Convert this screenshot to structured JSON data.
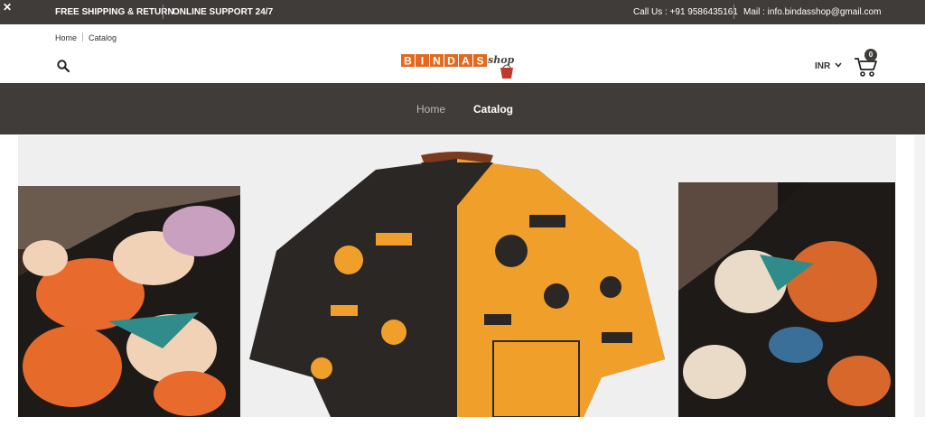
{
  "topbar": {
    "close_glyph": "✕",
    "shipping": "FREE SHIPPING & RETURN",
    "support": "ONLINE SUPPORT 24/7",
    "call": "Call Us : +91 9586435161",
    "mail": "Mail : info.bindasshop@gmail.com"
  },
  "breadcrumb": {
    "home": "Home",
    "catalog": "Catalog"
  },
  "header": {
    "currency": "INR",
    "cart_count": "0"
  },
  "logo": {
    "letters": [
      "B",
      "I",
      "N",
      "D",
      "A",
      "S"
    ],
    "script": "shop"
  },
  "nav": {
    "home": "Home",
    "catalog": "Catalog"
  },
  "colors": {
    "dark": "#403c3a",
    "orange": "#e2691f",
    "shirt_orange": "#f0a02a"
  },
  "icons": [
    "close-icon",
    "search-icon",
    "chevron-down-icon",
    "cart-icon"
  ]
}
